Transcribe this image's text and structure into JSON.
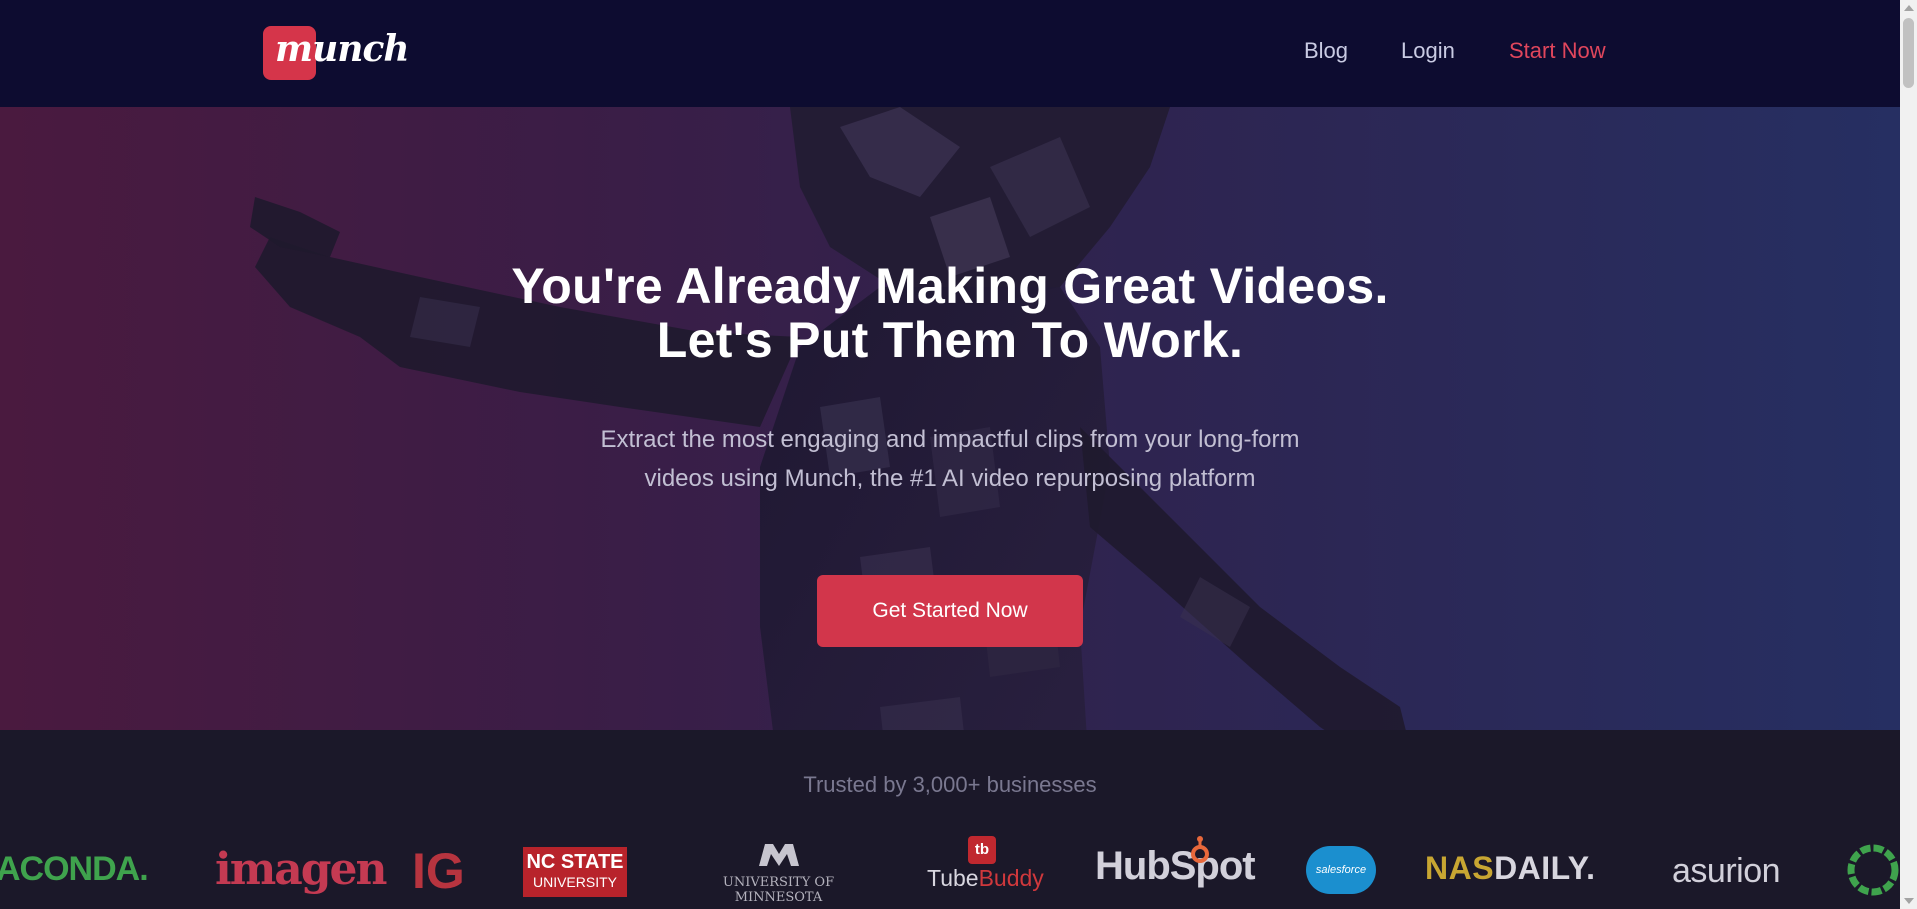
{
  "brand": {
    "name": "munch"
  },
  "nav": {
    "blog": "Blog",
    "login": "Login",
    "start": "Start Now"
  },
  "hero": {
    "title_line1": "You're Already Making Great Videos.",
    "title_line2": "Let's Put Them To Work.",
    "subtitle_line1": "Extract the most engaging and impactful clips from your long-form",
    "subtitle_line2": "videos using Munch, the #1 AI video repurposing platform",
    "cta": "Get Started Now"
  },
  "trusted": {
    "label": "Trusted by 3,000+ businesses",
    "logos": {
      "anaconda": "ACONDA.",
      "imagen": "imagen",
      "ig": "IG",
      "ncstate_1": "NC STATE",
      "ncstate_2": "UNIVERSITY",
      "minnesota": "UNIVERSITY OF MINNESOTA",
      "tubebuddy_tube": "Tube",
      "tubebuddy_buddy": "Buddy",
      "tubebuddy_mark": "tb",
      "hubspot": "HubSpot",
      "salesforce": "salesforce",
      "nasdaily_nas": "NAS",
      "nasdaily_daily": "DAILY.",
      "asurion": "asurion"
    }
  },
  "colors": {
    "accent": "#d2364b",
    "header_bg": "#0d0c30",
    "band_bg": "#1b1829"
  }
}
